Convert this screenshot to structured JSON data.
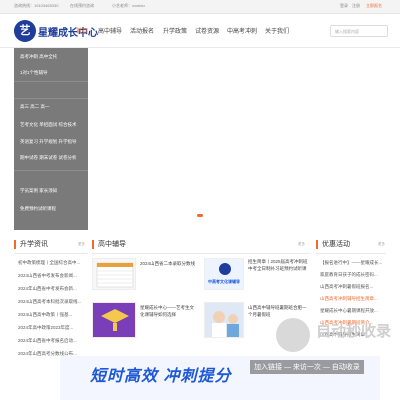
{
  "topbar": {
    "phone": "咨询热线：19103465330",
    "online": "在线预约咨询",
    "contact": "小艺老师：xxxedu",
    "login": "登录",
    "register": "注册",
    "apply": "立即报名"
  },
  "header": {
    "logo_badge": "艺",
    "logo_text": "星耀成长中心",
    "nav": [
      "首页",
      "高中辅导",
      "活动报名",
      "升学政策",
      "试卷资源",
      "中高考冲刺",
      "关于我们"
    ],
    "search_placeholder": "输入搜索内容"
  },
  "dropdown": {
    "rows": [
      "高考冲刺    高中全托",
      "1对1个性辅导",
      "高三    高二    高一",
      "艺考文化  单招面试  综合技术",
      "英语复习  升学规划  升学指导",
      "期中试卷  期末试卷  试卷分析",
      "学员案例    家长须知",
      "免费预约试听课程"
    ]
  },
  "columns": {
    "news": {
      "title": "升学资讯",
      "more": "更多",
      "items": [
        "初中政策梳理丨全国综合高中...",
        "2024山西省中考发布会新闻...",
        "2024年山西省中考发布会新...",
        "2024山西高考本科批次录取线...",
        "2024山西高中政策丨强基...",
        "2024年高中政策2023年度...",
        "2024年山西省中考报名启动...",
        "2024年山西高考分数线公布..."
      ]
    },
    "tutoring": {
      "title": "高中辅导",
      "more": "更多",
      "cards": [
        {
          "text": "2024山西省二本录取分数线"
        },
        {
          "text": "招生简章丨2025届高考冲刺班中考全日制补习班预约试听课"
        },
        {
          "text": "星耀成长中心——艺考生文化课辅导如何选择"
        },
        {
          "text": "山西高中辅导班暑期班合肥一个月暑假班"
        }
      ],
      "thumb_label": "中高考文化课辅导"
    },
    "events": {
      "title": "优惠活动",
      "more": "更多",
      "items": [
        "【报名进行中】——星耀成长...",
        "家庭教育日孩子的成长密码...",
        "山西高考冲刺暑假班报名...",
        "山西高考冲刺辅导招生简章...",
        "星耀成长中心暑期课程开放...",
        "山西高考冲刺暑期班简介...",
        "山西高中辅导招生简章..."
      ]
    }
  },
  "banner": {
    "text": "短时高效 冲刺提分"
  },
  "watermark": {
    "title": "自动秒收录",
    "sub": "加入链接 — 来访一次 — 自动收录"
  },
  "colors": {
    "accent": "#f26a2e",
    "brand": "#1f3e9c",
    "dropdown_bg": "#7a7a7a"
  }
}
